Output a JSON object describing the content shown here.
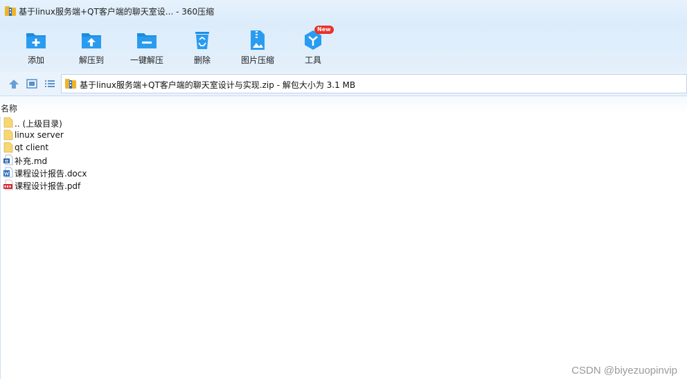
{
  "window": {
    "title": "基于linux服务端+QT客户端的聊天室设... - 360压缩"
  },
  "toolbar": {
    "items": [
      {
        "label": "添加",
        "icon": "add-folder-icon"
      },
      {
        "label": "解压到",
        "icon": "extract-to-icon"
      },
      {
        "label": "一键解压",
        "icon": "one-click-extract-icon"
      },
      {
        "label": "删除",
        "icon": "recycle-bin-icon"
      },
      {
        "label": "图片压缩",
        "icon": "image-compress-icon"
      },
      {
        "label": "工具",
        "icon": "tools-icon",
        "badge": "New"
      }
    ]
  },
  "addressbar": {
    "path": "基于linux服务端+QT客户端的聊天室设计与实现.zip - 解包大小为 3.1 MB"
  },
  "list": {
    "column_name": "名称",
    "items": [
      {
        "name": ".. (上级目录)",
        "icon": "folder-icon"
      },
      {
        "name": "linux server",
        "icon": "folder-icon"
      },
      {
        "name": "qt client",
        "icon": "folder-icon"
      },
      {
        "name": "补充.md",
        "icon": "markdown-file-icon"
      },
      {
        "name": "课程设计报告.docx",
        "icon": "word-file-icon"
      },
      {
        "name": "课程设计报告.pdf",
        "icon": "pdf-file-icon"
      }
    ]
  },
  "watermark": "CSDN @biyezuopinvip",
  "colors": {
    "accent": "#1d8ce0",
    "toolbar_bg": "#dcecfb",
    "badge": "#e8322a"
  }
}
